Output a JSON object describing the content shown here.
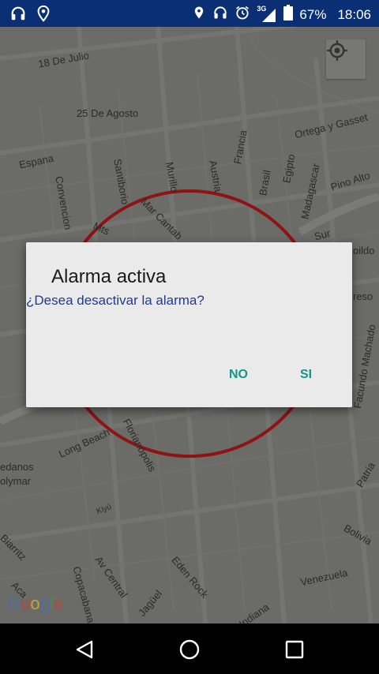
{
  "status_bar": {
    "left_icons": [
      "headphones-icon",
      "location-pin-icon"
    ],
    "right_icons": [
      "location-icon",
      "headphones-icon",
      "alarm-icon",
      "signal-3g-icon",
      "battery-icon"
    ],
    "network": "3G",
    "battery": "67%",
    "time": "18:06"
  },
  "map": {
    "streets": [
      {
        "id": "18-de-julio",
        "text": "18 De Julio"
      },
      {
        "id": "25-de-agosto",
        "text": "25 De Agosto"
      },
      {
        "id": "ortega-y-gasset",
        "text": "Ortega y Gasset"
      },
      {
        "id": "espana",
        "text": "Espana"
      },
      {
        "id": "convencion",
        "text": "Convencion"
      },
      {
        "id": "santiborio",
        "text": "Santiborio"
      },
      {
        "id": "murillo",
        "text": "Murillo"
      },
      {
        "id": "austria",
        "text": "Austria"
      },
      {
        "id": "francia",
        "text": "Francia"
      },
      {
        "id": "brasil",
        "text": "Brasil"
      },
      {
        "id": "egipto",
        "text": "Egipto"
      },
      {
        "id": "madagascar",
        "text": "Madagascar"
      },
      {
        "id": "pino-alto",
        "text": "Pino Alto"
      },
      {
        "id": "mar-cantab",
        "text": "Mar Cantab"
      },
      {
        "id": "mts",
        "text": "Mts"
      },
      {
        "id": "sur",
        "text": "Sur"
      },
      {
        "id": "bildo",
        "text": "oildo"
      },
      {
        "id": "reso",
        "text": "reso"
      },
      {
        "id": "facundo-machado",
        "text": "Facundo Machado"
      },
      {
        "id": "long-beach",
        "text": "Long Beach"
      },
      {
        "id": "florianopolis",
        "text": "Florianopolis"
      },
      {
        "id": "edanos",
        "text": "edanos"
      },
      {
        "id": "olymar",
        "text": "olymar"
      },
      {
        "id": "kiyu",
        "text": "Kiyú"
      },
      {
        "id": "biarritz",
        "text": "Biarritz"
      },
      {
        "id": "av-central",
        "text": "Av Central"
      },
      {
        "id": "eden-rock",
        "text": "Eden Rock"
      },
      {
        "id": "copacabana",
        "text": "Copacabana"
      },
      {
        "id": "jaguel",
        "text": "Jagüel"
      },
      {
        "id": "acapulco",
        "text": "Aca"
      },
      {
        "id": "indiana",
        "text": "Indiana"
      },
      {
        "id": "venezuela",
        "text": "Venezuela"
      },
      {
        "id": "bolivia",
        "text": "Bolivia"
      },
      {
        "id": "patria",
        "text": "Patria"
      }
    ],
    "geofence_color": "#8e1313",
    "locate_button": "my-location-icon",
    "attribution": "Google"
  },
  "dialog": {
    "title": "Alarma activa",
    "message": "¿Desea desactivar la alarma?",
    "negative": "NO",
    "positive": "SI",
    "accent": "#15968a"
  },
  "nav_bar": {
    "buttons": [
      "back-icon",
      "home-icon",
      "recents-icon"
    ]
  }
}
